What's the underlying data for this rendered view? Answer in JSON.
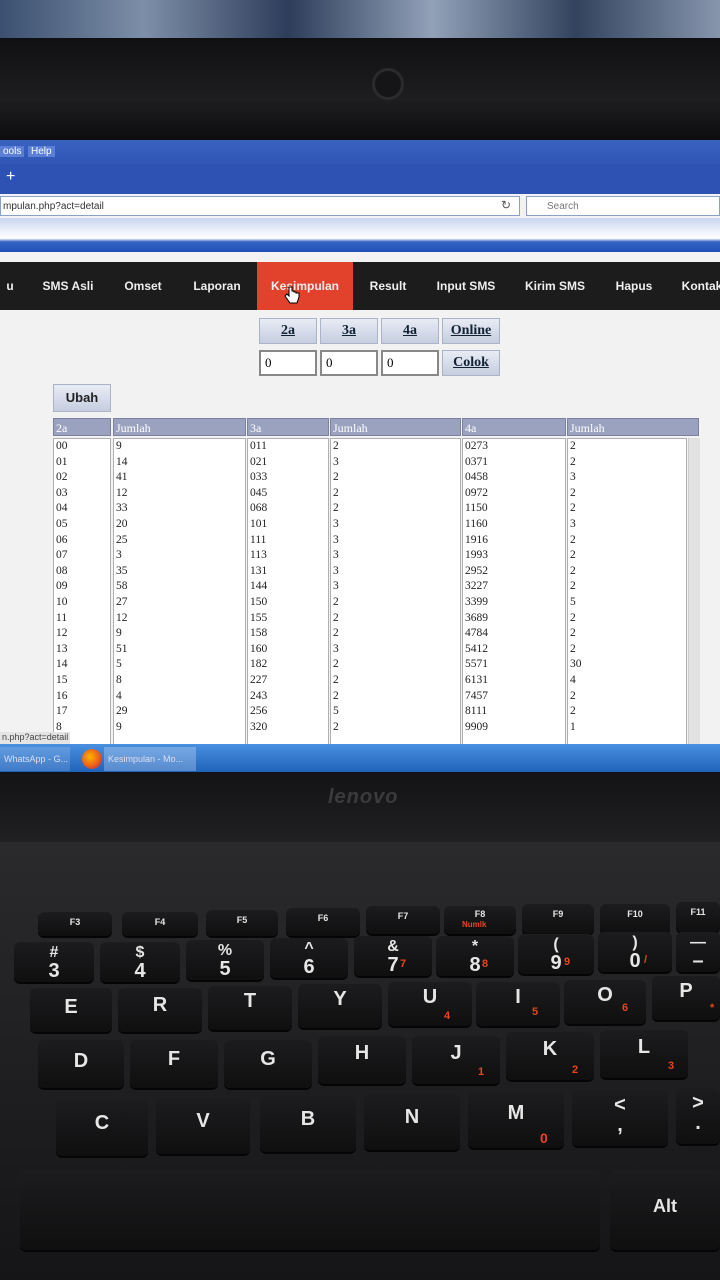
{
  "browser": {
    "menu": [
      "ools",
      "Help"
    ],
    "new_tab": "+",
    "url": "mpulan.php?act=detail",
    "reload_icon": "↻",
    "search_placeholder": "Search"
  },
  "nav": [
    "u",
    "SMS Asli",
    "Omset",
    "Laporan",
    "Kesimpulan",
    "Result",
    "Input SMS",
    "Kirim SMS",
    "Hapus",
    "Kontak"
  ],
  "nav_active_index": 4,
  "controls": {
    "btn_2a": "2a",
    "btn_3a": "3a",
    "btn_4a": "4a",
    "btn_online": "Online",
    "btn_colok": "Colok",
    "input_2a": "0",
    "input_3a": "0",
    "input_4a": "0",
    "ubah": "Ubah"
  },
  "table": {
    "headers": [
      "2a",
      "Jumlah",
      "3a",
      "Jumlah",
      "4a",
      "Jumlah"
    ],
    "col_2a": [
      "00",
      "01",
      "02",
      "03",
      "04",
      "05",
      "06",
      "07",
      "08",
      "09",
      "10",
      "11",
      "12",
      "13",
      "14",
      "15",
      "16",
      "17",
      "8"
    ],
    "col_2a_jumlah": [
      "9",
      "14",
      "41",
      "12",
      "33",
      "20",
      "25",
      "3",
      "35",
      "58",
      "27",
      "12",
      "9",
      "51",
      "5",
      "8",
      "4",
      "29",
      "9"
    ],
    "col_3a": [
      "011",
      "021",
      "033",
      "045",
      "068",
      "101",
      "111",
      "113",
      "131",
      "144",
      "150",
      "155",
      "158",
      "160",
      "182",
      "227",
      "243",
      "256",
      "320"
    ],
    "col_3a_jumlah": [
      "2",
      "3",
      "2",
      "2",
      "2",
      "3",
      "3",
      "3",
      "3",
      "3",
      "2",
      "2",
      "2",
      "3",
      "2",
      "2",
      "2",
      "5",
      "2"
    ],
    "col_4a": [
      "0273",
      "0371",
      "0458",
      "0972",
      "1150",
      "1160",
      "1916",
      "1993",
      "2952",
      "3227",
      "3399",
      "3689",
      "4784",
      "5412",
      "5571",
      "6131",
      "7457",
      "8111",
      "9909"
    ],
    "col_4a_jumlah": [
      "2",
      "2",
      "3",
      "2",
      "2",
      "3",
      "2",
      "2",
      "2",
      "2",
      "5",
      "2",
      "2",
      "2",
      "30",
      "4",
      "2",
      "2",
      "1"
    ]
  },
  "status_url": "n.php?act=detail",
  "taskbar": [
    "WhatsApp - G...",
    "Kesimpulan - Mo..."
  ],
  "laptop_brand": "lenovo",
  "keyboard": {
    "fkeys": [
      "F3",
      "F4",
      "F5",
      "F6",
      "F7",
      "F8",
      "F9",
      "F10",
      "F11"
    ],
    "f8_sub": "Numlk",
    "row_num": [
      [
        "#",
        "3"
      ],
      [
        "$",
        "4"
      ],
      [
        "%",
        "5"
      ],
      [
        "^",
        "6"
      ],
      [
        "&",
        "7"
      ],
      [
        "*",
        "8"
      ],
      [
        "(",
        "9"
      ],
      [
        ")",
        "0"
      ],
      [
        "—",
        "–"
      ]
    ],
    "row_num_numpad": [
      "",
      "",
      "",
      "",
      "7",
      "8",
      "9",
      "/",
      ""
    ],
    "row_q": [
      "E",
      "R",
      "T",
      "Y",
      "U",
      "I",
      "O",
      "P"
    ],
    "row_q_numpad": [
      "",
      "",
      "",
      "",
      "4",
      "5",
      "6",
      "*"
    ],
    "row_a": [
      "D",
      "F",
      "G",
      "H",
      "J",
      "K",
      "L"
    ],
    "row_a_numpad": [
      "",
      "",
      "",
      "",
      "1",
      "2",
      "3"
    ],
    "row_z": [
      "C",
      "V",
      "B",
      "N",
      "M",
      "<",
      ">"
    ],
    "row_z_sub": [
      "",
      "",
      "",
      "",
      "0",
      ",",
      "."
    ],
    "alt": "Alt"
  }
}
